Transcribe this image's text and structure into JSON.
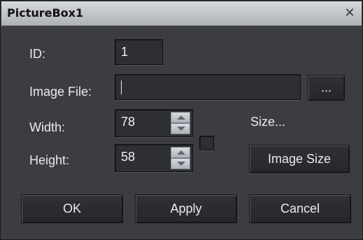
{
  "window": {
    "title": "PictureBox1",
    "close_icon": "close-icon"
  },
  "fields": {
    "id_label": "ID:",
    "id_value": "1",
    "image_file_label": "Image File:",
    "image_file_value": "",
    "browse_label": "...",
    "width_label": "Width:",
    "width_value": "78",
    "height_label": "Height:",
    "height_value": "58",
    "size_label": "Size...",
    "image_size_label": "Image Size"
  },
  "buttons": {
    "ok": "OK",
    "apply": "Apply",
    "cancel": "Cancel"
  },
  "colors": {
    "dialog_bg": "#3b3d40",
    "titlebar": "#c4c7cb",
    "text": "#e9eaec"
  }
}
